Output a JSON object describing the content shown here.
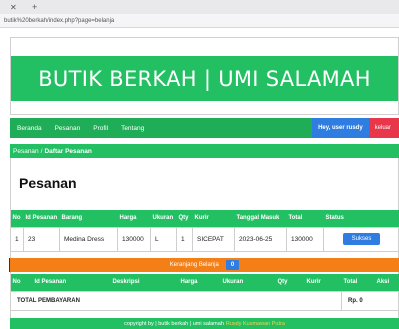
{
  "browser": {
    "url": "butik%20berkah/index.php?page=belanja"
  },
  "header": {
    "title": "BUTIK BERKAH | UMI SALAMAH"
  },
  "nav": {
    "items": [
      "Beranda",
      "Pesanan",
      "Profil",
      "Tentang"
    ],
    "user_label": "Hey, user rusdy",
    "logout_label": "keluar"
  },
  "breadcrumb": {
    "parent": "Pesanan",
    "separator": "/",
    "current": "Daftar Pesanan"
  },
  "page_title": "Pesanan",
  "orders": {
    "columns": [
      "No",
      "Id Pesanan",
      "Barang",
      "Harga",
      "Ukuran",
      "Qty",
      "Kurir",
      "Tanggal Masuk",
      "Total",
      "Status"
    ],
    "rows": [
      {
        "no": "1",
        "id": "23",
        "barang": "Medina Dress",
        "harga": "130000",
        "ukuran": "L",
        "qty": "1",
        "kurir": "SICEPAT",
        "tanggal": "2023-06-25",
        "total": "130000",
        "status": "Sukses"
      }
    ]
  },
  "cart_bar": {
    "label": "Keranjang Belanja",
    "count": "0"
  },
  "cart": {
    "columns": [
      "No",
      "Id Pesanan",
      "Deskripsi",
      "Harga",
      "Ukuran",
      "Qty",
      "Kurir",
      "Total",
      "Aksi"
    ],
    "total_label": "TOTAL PEMBAYARAN",
    "total_value": "Rp. 0"
  },
  "footer": {
    "text": "copyright by | butik berkah | umi salamah",
    "link": "Rusdy Kusmawan Putra"
  },
  "colors": {
    "green": "#23c063",
    "blue": "#2f7de0",
    "orange": "#f57f17",
    "red": "#e8374a"
  }
}
